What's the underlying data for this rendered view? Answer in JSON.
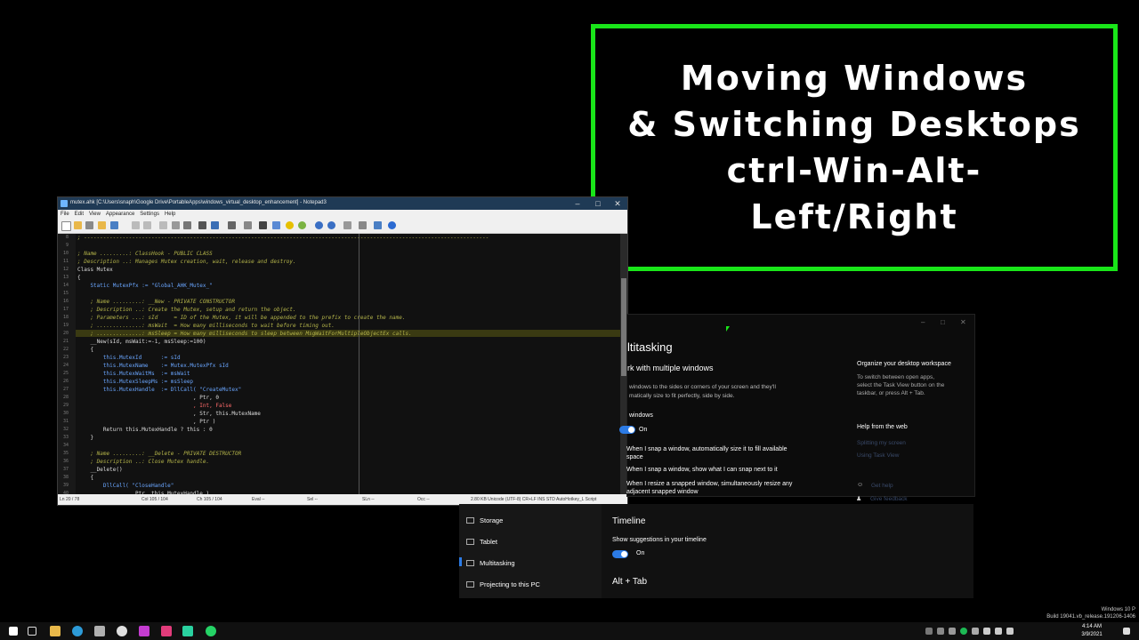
{
  "banner": {
    "lines": [
      "Moving Windows",
      "& Switching Desktops",
      "ctrl-Win-Alt-",
      "Left/Right"
    ]
  },
  "notepad": {
    "title": "mutex.ahk [C:\\Users\\snaph\\Google Drive\\PortableApps\\windows_virtual_desktop_enhancement] - Notepad3",
    "menu": [
      "File",
      "Edit",
      "View",
      "Appearance",
      "Settings",
      "Help"
    ],
    "lines": [
      {
        "n": "8",
        "t": "; ------------------------------------------------------------------------------------------------------------------------------",
        "c": "cm"
      },
      {
        "n": "9",
        "t": "",
        "c": ""
      },
      {
        "n": "10",
        "t": "; Name .........: ClassHook - PUBLIC CLASS",
        "c": "cm"
      },
      {
        "n": "11",
        "t": "; Description ..: Manages Mutex creation, wait, release and destroy.",
        "c": "cm"
      },
      {
        "n": "12",
        "t": "Class Mutex",
        "c": ""
      },
      {
        "n": "13",
        "t": "{",
        "c": ""
      },
      {
        "n": "14",
        "t": "    Static MutexPfx := \"Global_AHK_Mutex_\"",
        "c": "kw"
      },
      {
        "n": "15",
        "t": "",
        "c": ""
      },
      {
        "n": "16",
        "t": "    ; Name .........: __New - PRIVATE CONSTRUCTOR",
        "c": "cm"
      },
      {
        "n": "17",
        "t": "    ; Description ..: Create the Mutex, setup and return the object.",
        "c": "cm"
      },
      {
        "n": "18",
        "t": "    ; Parameters ...: sId     = ID of the Mutex, it will be appended to the prefix to create the name.",
        "c": "cm"
      },
      {
        "n": "19",
        "t": "    ; ..............: msWait  = How many milliseconds to wait before timing out.",
        "c": "cm"
      },
      {
        "n": "20",
        "t": "    ; ..............: msSleep = How many milliseconds to sleep between MsgWaitForMultipleObjectEx calls.",
        "c": "cm"
      },
      {
        "n": "21",
        "t": "    __New(sId, msWait:=-1, msSleep:=100)",
        "c": ""
      },
      {
        "n": "22",
        "t": "    {",
        "c": ""
      },
      {
        "n": "23",
        "t": "        this.MutexId      := sId",
        "c": "kw"
      },
      {
        "n": "24",
        "t": "        this.MutexName    := Mutex.MutexPfx sId",
        "c": "kw"
      },
      {
        "n": "25",
        "t": "        this.MutexWaitMs  := msWait",
        "c": "kw"
      },
      {
        "n": "26",
        "t": "        this.MutexSleepMs := msSleep",
        "c": "kw"
      },
      {
        "n": "27",
        "t": "        this.MutexHandle  := DllCall( \"CreateMutex\"",
        "c": "kw"
      },
      {
        "n": "28",
        "t": "                                    , Ptr, 0",
        "c": ""
      },
      {
        "n": "29",
        "t": "                                    , Int, False",
        "c": "nm"
      },
      {
        "n": "30",
        "t": "                                    , Str, this.MutexName",
        "c": ""
      },
      {
        "n": "31",
        "t": "                                    , Ptr )",
        "c": ""
      },
      {
        "n": "32",
        "t": "        Return this.MutexHandle ? this : 0",
        "c": ""
      },
      {
        "n": "33",
        "t": "    }",
        "c": ""
      },
      {
        "n": "34",
        "t": "",
        "c": ""
      },
      {
        "n": "35",
        "t": "    ; Name .........: __Delete - PRIVATE DESTRUCTOR",
        "c": "cm"
      },
      {
        "n": "36",
        "t": "    ; Description ..: Close Mutex handle.",
        "c": "cm"
      },
      {
        "n": "37",
        "t": "    __Delete()",
        "c": ""
      },
      {
        "n": "38",
        "t": "    {",
        "c": ""
      },
      {
        "n": "39",
        "t": "        DllCall( \"CloseHandle\"",
        "c": "kw"
      },
      {
        "n": "40",
        "t": "                , Ptr, this.MutexHandle )",
        "c": ""
      }
    ],
    "status": {
      "ln": "Ln 20 / 78",
      "col": "Col 105 / 104",
      "ch": "Ch 105 / 104",
      "eval": "Eval --",
      "sel": "Sel --",
      "sln": "SLn --",
      "occ": "Occ --",
      "right": "2.80 KB  Unicode (UTF-8)  CR+LF  INS  STD  AutoHotkey_L Script"
    }
  },
  "settings": {
    "heading": "ltitasking",
    "section": "rk with multiple windows",
    "desc1": "windows to the sides or corners of your screen and they'll",
    "desc2": "matically size to fit perfectly, side by side.",
    "snap_label": "windows",
    "snap_on": "On",
    "opt1a": "When I snap a window, automatically size it to fill available",
    "opt1b": "space",
    "opt2": "When I snap a window, show what I can snap next to it",
    "opt3a": "When I resize a snapped window, simultaneously resize any",
    "opt3b": "adjacent snapped window",
    "right_title": "Organize your desktop workspace",
    "right_desc1": "To switch between open apps,",
    "right_desc2": "select the Task View button on the",
    "right_desc3": "taskbar, or press Alt + Tab.",
    "help_title": "Help from the web",
    "link1": "Splitting my screen",
    "link2": "Using Task View",
    "get_help": "Get help",
    "feedback": "Give feedback",
    "nav": [
      "Storage",
      "Tablet",
      "Multitasking",
      "Projecting to this PC"
    ],
    "timeline": "Timeline",
    "timeline_desc": "Show suggestions in your timeline",
    "timeline_on": "On",
    "alt_tab": "Alt + Tab"
  },
  "taskbar": {
    "watermark1": "Windows 10 P",
    "watermark2": "Build 19041.vb_release.191206-1406",
    "time": "4:14 AM",
    "date": "3/9/2021"
  }
}
